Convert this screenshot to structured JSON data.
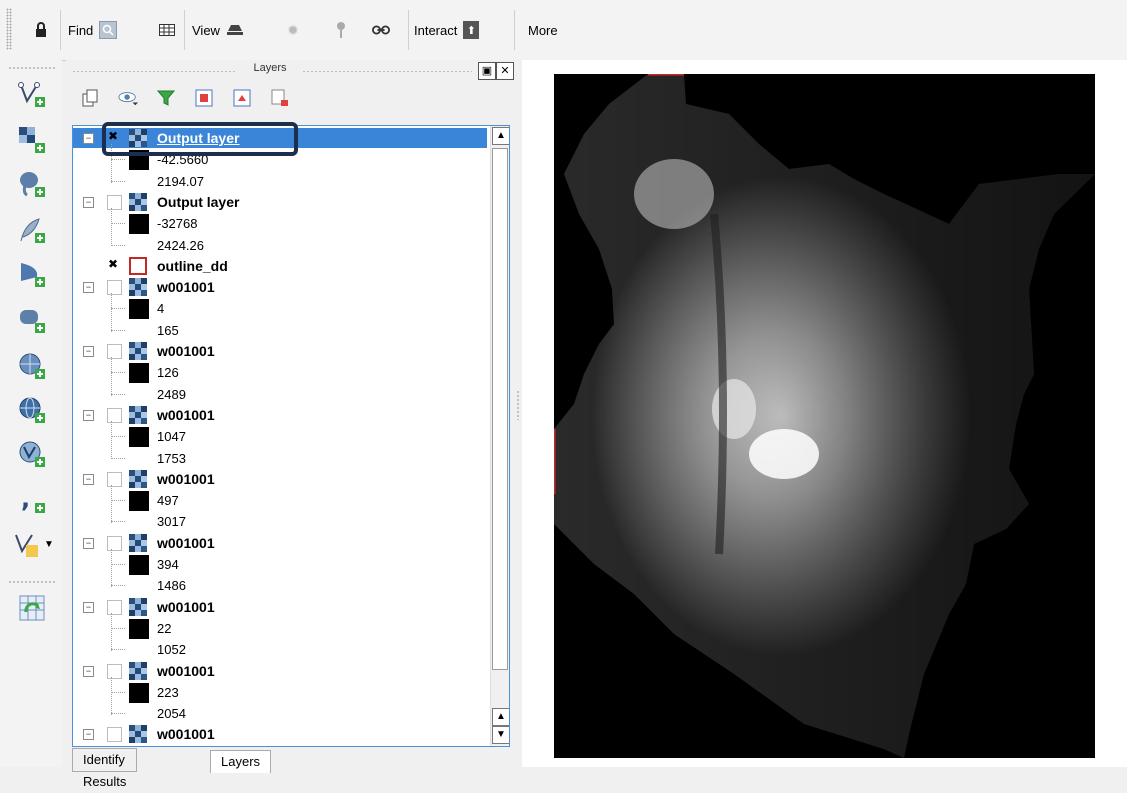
{
  "toolbar": {
    "find_label": "Find",
    "view_label": "View",
    "interact_label": "Interact",
    "more_label": "More"
  },
  "panel": {
    "title": "Layers",
    "tabs": [
      "Identify Results",
      "Layers"
    ]
  },
  "layers": [
    {
      "name": "Output layer",
      "checked": true,
      "selected": true,
      "type": "raster",
      "legend": [
        "-42.5660",
        "2194.07"
      ]
    },
    {
      "name": "Output layer",
      "checked": false,
      "type": "raster",
      "legend": [
        "-32768",
        "2424.26"
      ]
    },
    {
      "name": "outline_dd",
      "checked": true,
      "type": "vector",
      "legend": []
    },
    {
      "name": "w001001",
      "checked": false,
      "type": "raster",
      "legend": [
        "4",
        "165"
      ]
    },
    {
      "name": "w001001",
      "checked": false,
      "type": "raster",
      "legend": [
        "126",
        "2489"
      ]
    },
    {
      "name": "w001001",
      "checked": false,
      "type": "raster",
      "legend": [
        "1047",
        "1753"
      ]
    },
    {
      "name": "w001001",
      "checked": false,
      "type": "raster",
      "legend": [
        "497",
        "3017"
      ]
    },
    {
      "name": "w001001",
      "checked": false,
      "type": "raster",
      "legend": [
        "394",
        "1486"
      ]
    },
    {
      "name": "w001001",
      "checked": false,
      "type": "raster",
      "legend": [
        "22",
        "1052"
      ]
    },
    {
      "name": "w001001",
      "checked": false,
      "type": "raster",
      "legend": [
        "223",
        "2054"
      ]
    },
    {
      "name": "w001001",
      "checked": false,
      "type": "raster",
      "legend": []
    }
  ],
  "colors": {
    "selection_blue": "#3a85d8",
    "highlight_border": "#1c2f4f",
    "outline_red": "#c62828"
  }
}
